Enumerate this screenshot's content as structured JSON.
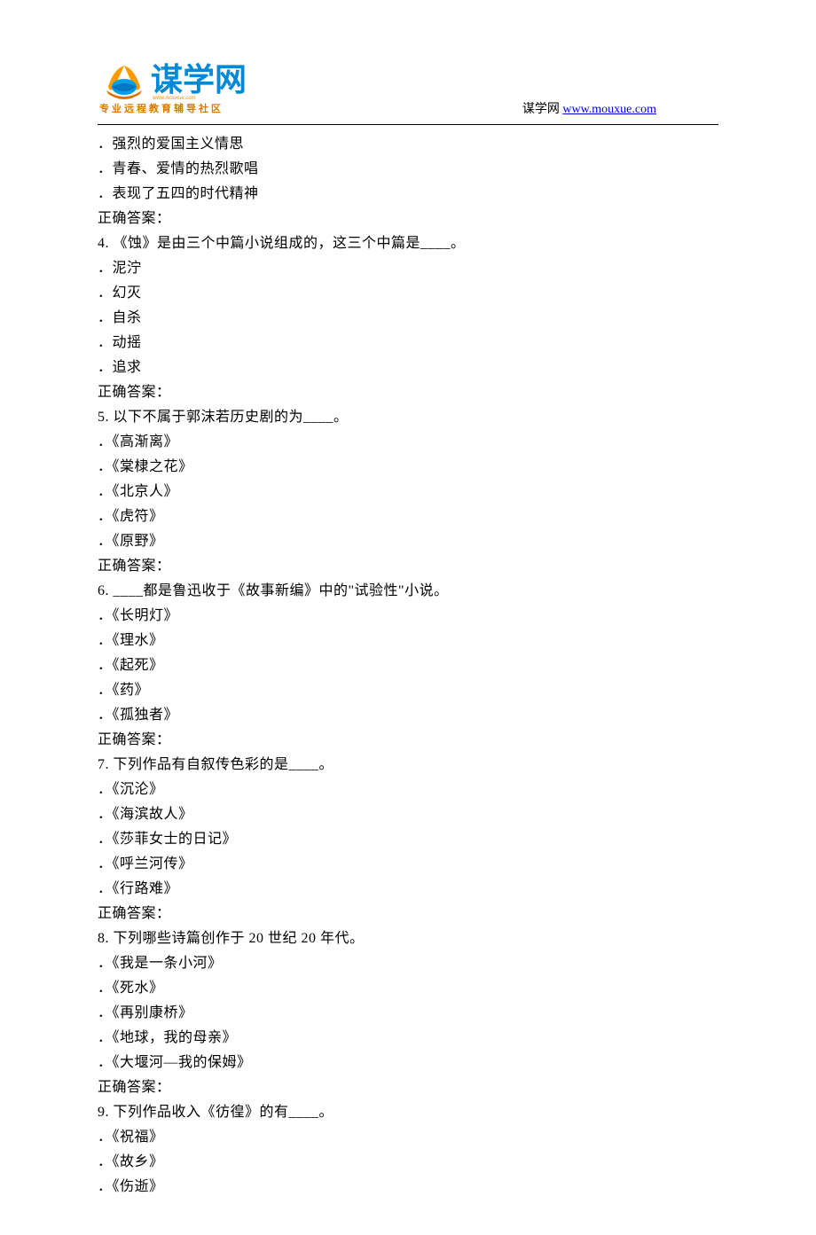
{
  "header": {
    "logo_main": "谋学网",
    "logo_tiny": "www.mouxue.com",
    "logo_sub": "专业远程教育辅导社区",
    "site_prefix": "谋学网 ",
    "site_url": "www.mouxue.com"
  },
  "intro_options": [
    "．强烈的爱国主义情思",
    "．青春、爱情的热烈歌唱",
    "．表现了五四的时代精神"
  ],
  "intro_answer": "正确答案：",
  "questions": [
    {
      "stem": "4. 《蚀》是由三个中篇小说组成的，这三个中篇是____。",
      "options": [
        "．泥泞",
        "．幻灭",
        "．自杀",
        "．动摇",
        "．追求"
      ],
      "answer": "正确答案："
    },
    {
      "stem": "5. 以下不属于郭沫若历史剧的为____。",
      "options": [
        "．《高渐离》",
        "．《棠棣之花》",
        "．《北京人》",
        "．《虎符》",
        "．《原野》"
      ],
      "answer": "正确答案："
    },
    {
      "stem": "6. ____都是鲁迅收于《故事新编》中的\"试验性\"小说。",
      "options": [
        "．《长明灯》",
        "．《理水》",
        "．《起死》",
        "．《药》",
        "．《孤独者》"
      ],
      "answer": "正确答案："
    },
    {
      "stem": "7. 下列作品有自叙传色彩的是____。",
      "options": [
        "．《沉沦》",
        "．《海滨故人》",
        "．《莎菲女士的日记》",
        "．《呼兰河传》",
        "．《行路难》"
      ],
      "answer": "正确答案："
    },
    {
      "stem": "8. 下列哪些诗篇创作于 20 世纪 20 年代。",
      "options": [
        "．《我是一条小河》",
        "．《死水》",
        "．《再别康桥》",
        "．《地球，我的母亲》",
        "．《大堰河—我的保姆》"
      ],
      "answer": "正确答案："
    },
    {
      "stem": "9. 下列作品收入《彷徨》的有____。",
      "options": [
        "．《祝福》",
        "．《故乡》",
        "．《伤逝》"
      ],
      "answer": ""
    }
  ]
}
